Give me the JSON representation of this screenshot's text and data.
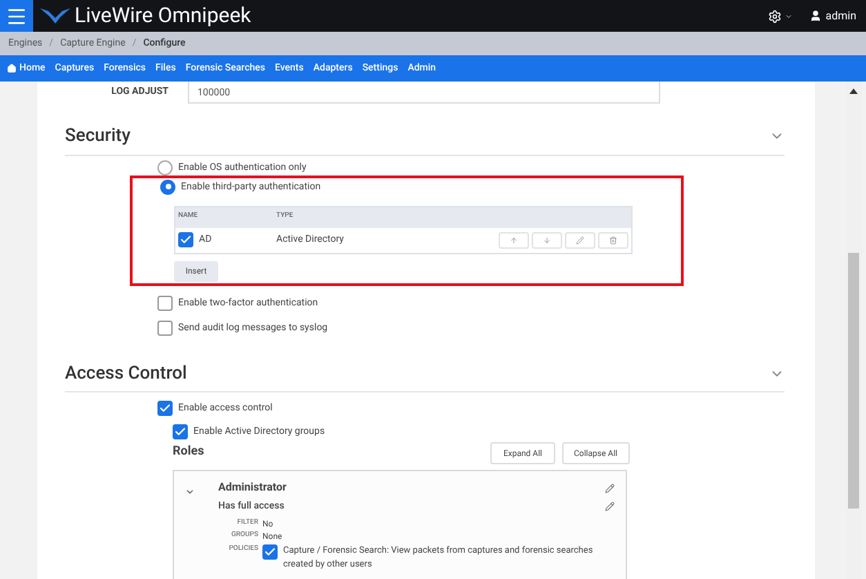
{
  "app": {
    "title": "LiveWire Omnipeek",
    "user": "admin"
  },
  "breadcrumb": [
    "Engines",
    "Capture Engine",
    "Configure"
  ],
  "breadcrumb_separator": "/",
  "nav": [
    {
      "label": "Home",
      "kind": "home"
    },
    {
      "label": "Captures"
    },
    {
      "label": "Forensics"
    },
    {
      "label": "Files"
    },
    {
      "label": "Forensic Searches"
    },
    {
      "label": "Events"
    },
    {
      "label": "Adapters"
    },
    {
      "label": "Settings"
    },
    {
      "label": "Admin"
    }
  ],
  "log_adjust": {
    "label": "LOG ADJUST",
    "value": "100000"
  },
  "security": {
    "title": "Security",
    "expanded": true,
    "auth_options": [
      {
        "label": "Enable OS authentication only",
        "selected": false
      },
      {
        "label": "Enable third-party authentication",
        "selected": true
      }
    ],
    "table": {
      "columns": [
        "NAME",
        "TYPE"
      ],
      "rows": [
        {
          "name": "AD",
          "type": "Active Directory",
          "checked": true
        }
      ]
    },
    "insert_button": "Insert",
    "options": [
      {
        "label": "Enable two-factor authentication",
        "checked": false
      },
      {
        "label": "Send audit log messages to syslog",
        "checked": false
      }
    ]
  },
  "access_control": {
    "title": "Access Control",
    "expanded": true,
    "enable": {
      "label": "Enable access control",
      "checked": true
    },
    "ad_groups": {
      "label": "Enable Active Directory groups",
      "checked": true
    },
    "roles_title": "Roles",
    "expand_all": "Expand All",
    "collapse_all": "Collapse All",
    "roles": [
      {
        "name": "Administrator",
        "description": "Has full access",
        "expanded": true,
        "fields": [
          {
            "label": "FILTER",
            "value": "No"
          },
          {
            "label": "GROUPS",
            "value": "None"
          }
        ],
        "policies_label": "POLICIES",
        "policies": [
          {
            "label": "Capture / Forensic Search: View packets from captures and forensic searches created by other users",
            "checked": true
          }
        ]
      }
    ]
  }
}
